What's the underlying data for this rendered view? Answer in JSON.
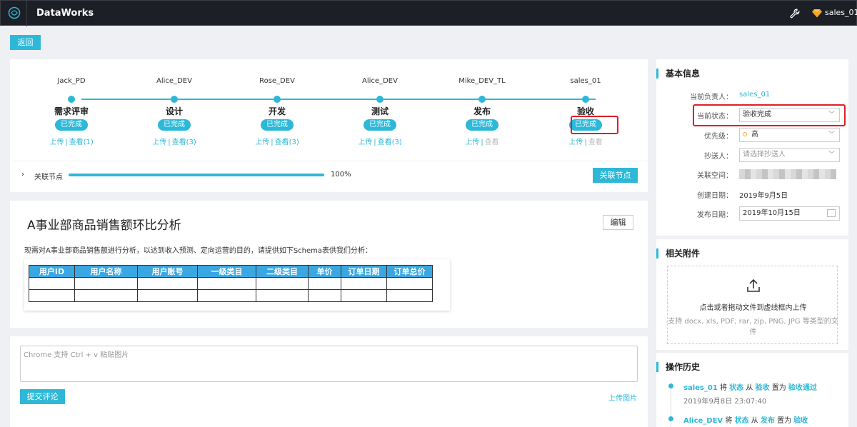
{
  "app": {
    "title": "DataWorks",
    "user": "sales_01"
  },
  "back_label": "返回",
  "flow": {
    "steps": [
      {
        "owner": "Jack_PD",
        "name": "需求评审",
        "status": "已完成",
        "upload": "上传",
        "view": "查看(1)"
      },
      {
        "owner": "Alice_DEV",
        "name": "设计",
        "status": "已完成",
        "upload": "上传",
        "view": "查看(3)"
      },
      {
        "owner": "Rose_DEV",
        "name": "开发",
        "status": "已完成",
        "upload": "上传",
        "view": "查看(3)"
      },
      {
        "owner": "Alice_DEV",
        "name": "测试",
        "status": "已完成",
        "upload": "上传",
        "view": "查看(3)"
      },
      {
        "owner": "Mike_DEV_TL",
        "name": "发布",
        "status": "已完成",
        "upload": "上传",
        "view": "查看"
      },
      {
        "owner": "sales_01",
        "name": "验收",
        "status": "已完成",
        "upload": "上传",
        "view": "查看"
      }
    ],
    "related_label": "关联节点",
    "progress": 100,
    "progress_text": "100%",
    "related_button": "关联节点"
  },
  "doc": {
    "title": "A事业部商品销售额环比分析",
    "edit_label": "编辑",
    "description": "现需对A事业部商品销售额进行分析，以达到收入预测、定向运营的目的，请提供如下Schema表供我们分析：",
    "schema_columns": [
      "用户ID",
      "用户名称",
      "用户账号",
      "一级类目",
      "二级类目",
      "单价",
      "订单日期",
      "订单总价"
    ]
  },
  "comment": {
    "placeholder": "Chrome 支持 Ctrl + v 粘贴图片",
    "submit_label": "提交评论",
    "upload_image_label": "上传图片"
  },
  "info": {
    "title": "基本信息",
    "owner_label": "当前负责人：",
    "owner_value": "sales_01",
    "status_label": "当前状态：",
    "status_value": "验收完成",
    "priority_label": "优先级：",
    "priority_value": "高",
    "cc_label": "抄送人：",
    "cc_placeholder": "请选择抄送人",
    "space_label": "关联空间：",
    "created_label": "创建日期：",
    "created_value": "2019年9月5日",
    "release_label": "发布日期：",
    "release_value": "2019年10月15日"
  },
  "attachments": {
    "title": "相关附件",
    "drop_text": "点击或者拖动文件到虚线框内上传",
    "drop_sub": "支持 docx, xls, PDF, rar, zip, PNG, JPG 等类型的文件"
  },
  "history": {
    "title": "操作历史",
    "items": [
      {
        "user": "sales_01",
        "w1": "将",
        "field": "状态",
        "w2": "从",
        "from": "验收",
        "w3": "置为",
        "to": "验收通过",
        "time": "2019年9月8日 23:07:40"
      },
      {
        "user": "Alice_DEV",
        "w1": "将",
        "field": "状态",
        "w2": "从",
        "from": "发布",
        "w3": "置为",
        "to": "验收",
        "time": ""
      }
    ]
  }
}
